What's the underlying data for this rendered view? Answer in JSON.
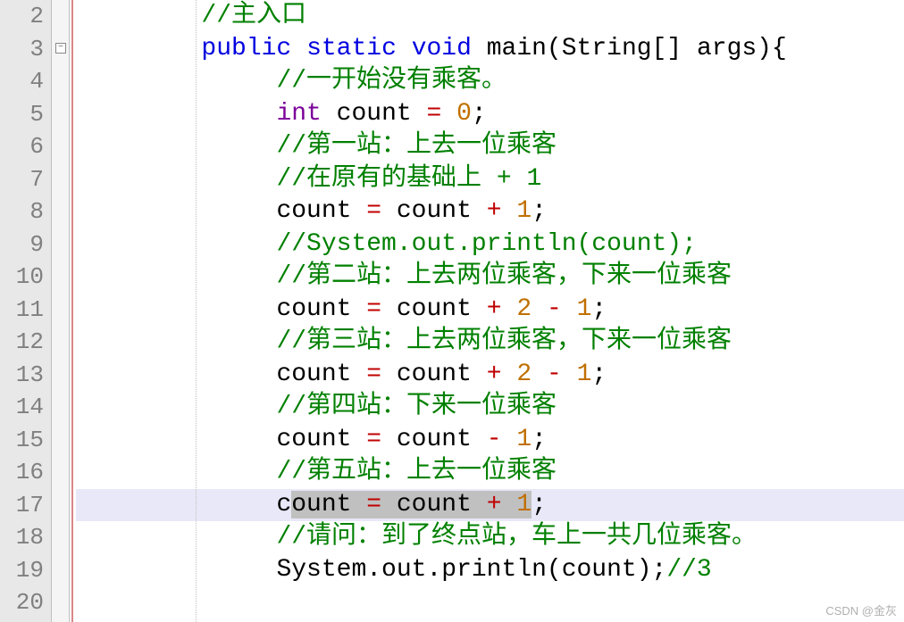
{
  "gutter": {
    "start": 2,
    "end": 20
  },
  "fold_marker_line": 3,
  "highlighted_line": 17,
  "code": {
    "l2": {
      "indent": "        ",
      "tokens": [
        {
          "t": "comment",
          "v": "//主入口"
        }
      ]
    },
    "l3": {
      "indent": "        ",
      "tokens": [
        {
          "t": "keyword",
          "v": "public"
        },
        {
          "t": "plain",
          "v": " "
        },
        {
          "t": "keyword",
          "v": "static"
        },
        {
          "t": "plain",
          "v": " "
        },
        {
          "t": "keyword",
          "v": "void"
        },
        {
          "t": "plain",
          "v": " main(String[] args){"
        }
      ]
    },
    "l4": {
      "indent": "             ",
      "tokens": [
        {
          "t": "comment",
          "v": "//一开始没有乘客。"
        }
      ]
    },
    "l5": {
      "indent": "             ",
      "tokens": [
        {
          "t": "type",
          "v": "int"
        },
        {
          "t": "plain",
          "v": " count "
        },
        {
          "t": "operator",
          "v": "="
        },
        {
          "t": "plain",
          "v": " "
        },
        {
          "t": "number",
          "v": "0"
        },
        {
          "t": "plain",
          "v": ";"
        }
      ]
    },
    "l6": {
      "indent": "             ",
      "tokens": [
        {
          "t": "comment",
          "v": "//第一站：上去一位乘客"
        }
      ]
    },
    "l7": {
      "indent": "             ",
      "tokens": [
        {
          "t": "comment",
          "v": "//在原有的基础上 + 1"
        }
      ]
    },
    "l8": {
      "indent": "             ",
      "tokens": [
        {
          "t": "plain",
          "v": "count "
        },
        {
          "t": "operator",
          "v": "="
        },
        {
          "t": "plain",
          "v": " count "
        },
        {
          "t": "operator",
          "v": "+"
        },
        {
          "t": "plain",
          "v": " "
        },
        {
          "t": "number",
          "v": "1"
        },
        {
          "t": "plain",
          "v": ";"
        }
      ]
    },
    "l9": {
      "indent": "             ",
      "tokens": [
        {
          "t": "comment",
          "v": "//System.out.println(count);"
        }
      ]
    },
    "l10": {
      "indent": "             ",
      "tokens": [
        {
          "t": "comment",
          "v": "//第二站：上去两位乘客，下来一位乘客"
        }
      ]
    },
    "l11": {
      "indent": "             ",
      "tokens": [
        {
          "t": "plain",
          "v": "count "
        },
        {
          "t": "operator",
          "v": "="
        },
        {
          "t": "plain",
          "v": " count "
        },
        {
          "t": "operator",
          "v": "+"
        },
        {
          "t": "plain",
          "v": " "
        },
        {
          "t": "number",
          "v": "2"
        },
        {
          "t": "plain",
          "v": " "
        },
        {
          "t": "operator",
          "v": "-"
        },
        {
          "t": "plain",
          "v": " "
        },
        {
          "t": "number",
          "v": "1"
        },
        {
          "t": "plain",
          "v": ";"
        }
      ]
    },
    "l12": {
      "indent": "             ",
      "tokens": [
        {
          "t": "comment",
          "v": "//第三站：上去两位乘客，下来一位乘客"
        }
      ]
    },
    "l13": {
      "indent": "             ",
      "tokens": [
        {
          "t": "plain",
          "v": "count "
        },
        {
          "t": "operator",
          "v": "="
        },
        {
          "t": "plain",
          "v": " count "
        },
        {
          "t": "operator",
          "v": "+"
        },
        {
          "t": "plain",
          "v": " "
        },
        {
          "t": "number",
          "v": "2"
        },
        {
          "t": "plain",
          "v": " "
        },
        {
          "t": "operator",
          "v": "-"
        },
        {
          "t": "plain",
          "v": " "
        },
        {
          "t": "number",
          "v": "1"
        },
        {
          "t": "plain",
          "v": ";"
        }
      ]
    },
    "l14": {
      "indent": "             ",
      "tokens": [
        {
          "t": "comment",
          "v": "//第四站：下来一位乘客"
        }
      ]
    },
    "l15": {
      "indent": "             ",
      "tokens": [
        {
          "t": "plain",
          "v": "count "
        },
        {
          "t": "operator",
          "v": "="
        },
        {
          "t": "plain",
          "v": " count "
        },
        {
          "t": "operator",
          "v": "-"
        },
        {
          "t": "plain",
          "v": " "
        },
        {
          "t": "number",
          "v": "1"
        },
        {
          "t": "plain",
          "v": ";"
        }
      ]
    },
    "l16": {
      "indent": "             ",
      "tokens": [
        {
          "t": "comment",
          "v": "//第五站：上去一位乘客"
        }
      ]
    },
    "l17": {
      "indent": "             ",
      "tokens": [
        {
          "t": "plain",
          "v": "c"
        },
        {
          "t": "selection",
          "v": "ount "
        },
        {
          "t": "sel-op",
          "v": "="
        },
        {
          "t": "selection",
          "v": " count "
        },
        {
          "t": "sel-op",
          "v": "+"
        },
        {
          "t": "selection",
          "v": " "
        },
        {
          "t": "sel-num",
          "v": "1"
        },
        {
          "t": "plain",
          "v": ";"
        }
      ]
    },
    "l18": {
      "indent": "             ",
      "tokens": [
        {
          "t": "comment",
          "v": "//请问：到了终点站，车上一共几位乘客。"
        }
      ]
    },
    "l19": {
      "indent": "             ",
      "tokens": [
        {
          "t": "plain",
          "v": "System.out.println(count);"
        },
        {
          "t": "comment",
          "v": "//3"
        }
      ]
    },
    "l20": {
      "indent": "",
      "tokens": []
    }
  },
  "watermark": "CSDN @金灰"
}
